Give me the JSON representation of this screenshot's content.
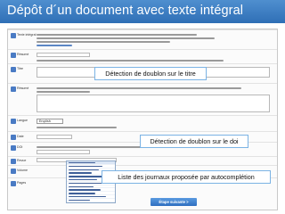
{
  "slide": {
    "title": "Dépôt d´un document avec texte intégral"
  },
  "form": {
    "sections": [
      {
        "label": "Texte intégral",
        "icon_color": "#4a7bc4"
      },
      {
        "label": "Résumé",
        "icon_color": "#4a7bc4"
      },
      {
        "label": "Titre",
        "icon_color": "#4a7bc4"
      },
      {
        "label": "Résumé",
        "icon_color": "#4a7bc4"
      },
      {
        "label": "Langue",
        "icon_color": "#4a7bc4"
      },
      {
        "label": "Date",
        "icon_color": "#4a7bc4"
      },
      {
        "label": "DOI",
        "icon_color": "#4a7bc4"
      },
      {
        "label": "Revue",
        "icon_color": "#4a7bc4"
      },
      {
        "label": "Volume",
        "icon_color": "#4a7bc4"
      },
      {
        "label": "Pages",
        "icon_color": "#4a7bc4"
      }
    ],
    "language_select": "English",
    "next_button": "Étape suivante >"
  },
  "callouts": {
    "title_duplicate": "Détection de doublon sur le titre",
    "doi_duplicate": "Détection de doublon sur le doi",
    "journal_autocomplete": "Liste des journaux proposée par autocomplétion"
  },
  "colors": {
    "title_bar_top": "#4f8fcf",
    "title_bar_bottom": "#2f6fb6",
    "callout_border": "#7bb3e4",
    "button": "#2f6fc0"
  }
}
